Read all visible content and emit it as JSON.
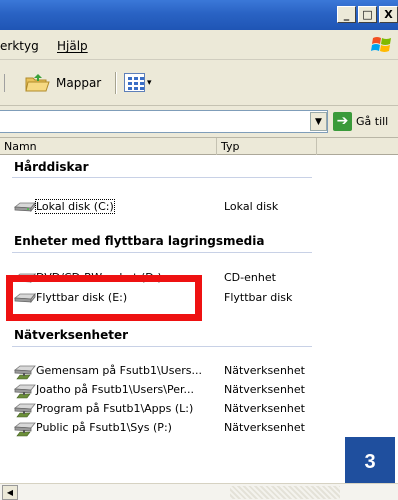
{
  "window": {
    "controls": {
      "minimize": "_",
      "maximize": "□",
      "close": "X"
    }
  },
  "menu": {
    "items": [
      {
        "label": "erktyg"
      },
      {
        "label": "Hjälp"
      }
    ]
  },
  "toolbar": {
    "folders_label": "Mappar",
    "view_icon": "views-icon"
  },
  "address": {
    "go_label": "Gå till"
  },
  "columns": {
    "name": "Namn",
    "type": "Typ"
  },
  "groups": [
    {
      "title": "Hårddiskar",
      "items": [
        {
          "name": "Lokal disk (C:)",
          "type": "Lokal disk",
          "icon": "hard-drive-icon"
        }
      ]
    },
    {
      "title": "Enheter med flyttbara lagringsmedia",
      "items": [
        {
          "name": "DVD/CD-RW-enhet (D:)",
          "type": "CD-enhet",
          "icon": "cd-drive-icon"
        },
        {
          "name": "Flyttbar disk (E:)",
          "type": "Flyttbar disk",
          "icon": "removable-drive-icon"
        }
      ]
    },
    {
      "title": "Nätverksenheter",
      "items": [
        {
          "name": "Gemensam på Fsutb1\\Users...",
          "type": "Nätverksenhet",
          "icon": "network-drive-icon"
        },
        {
          "name": "Joatho på Fsutb1\\Users\\Per...",
          "type": "Nätverksenhet",
          "icon": "network-drive-icon"
        },
        {
          "name": "Program på Fsutb1\\Apps (L:)",
          "type": "Nätverksenhet",
          "icon": "network-drive-icon"
        },
        {
          "name": "Public på Fsutb1\\Sys (P:)",
          "type": "Nätverksenhet",
          "icon": "network-drive-icon"
        }
      ]
    }
  ],
  "annotation": {
    "step": "3",
    "highlight_color": "#ee1111",
    "badge_color": "#1f4f9e"
  }
}
